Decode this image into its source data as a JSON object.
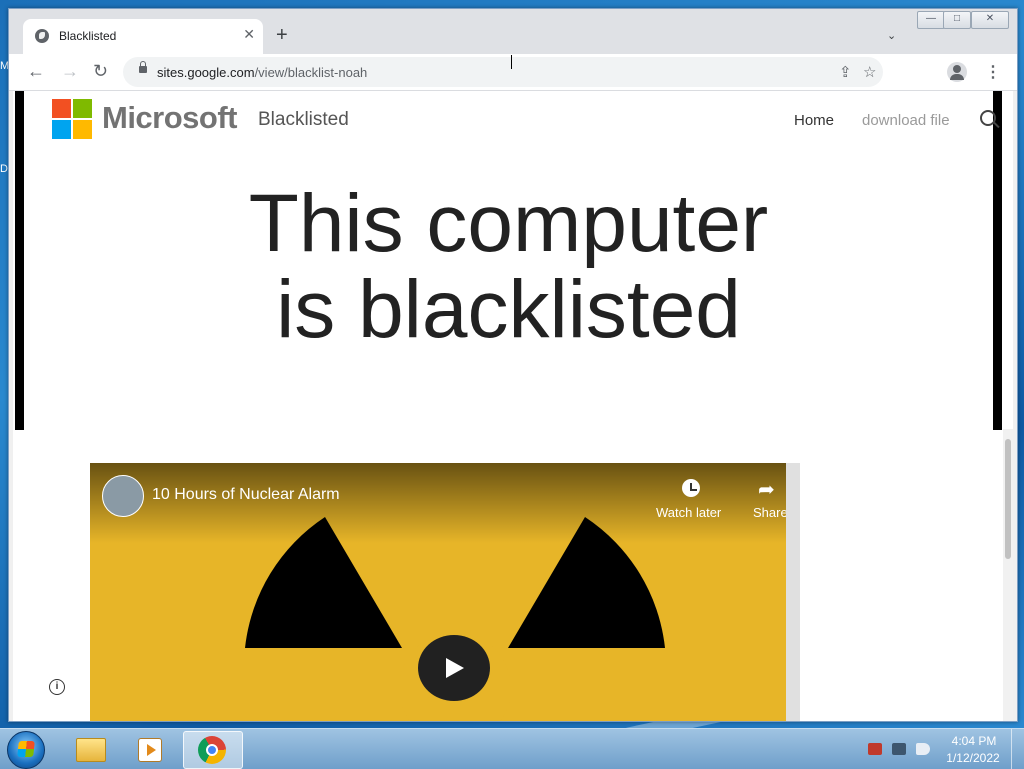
{
  "browser": {
    "tab": {
      "title": "Blacklisted",
      "close": "✕"
    },
    "new_tab": "+",
    "tab_search": "⌄",
    "window_controls": {
      "minimize": "—",
      "maximize": "□",
      "close": "✕"
    },
    "nav": {
      "back": "←",
      "forward": "→",
      "reload": "↻"
    },
    "url": {
      "host": "sites.google.com",
      "path": "/view/blacklist-noah"
    },
    "share_icon": "⇪",
    "bookmark_icon": "☆",
    "menu": "⋮"
  },
  "site": {
    "brand": "Microsoft",
    "site_name": "Blacklisted",
    "nav": {
      "home": "Home",
      "download": "download file"
    },
    "headline_line1": "This computer",
    "headline_line2": "is blacklisted",
    "info": "i",
    "colors": {
      "logo_red": "#f25022",
      "logo_green": "#7fba00",
      "logo_blue": "#00a4ef",
      "logo_yellow": "#ffb900"
    }
  },
  "video": {
    "title": "10 Hours of Nuclear Alarm",
    "watch_later": "Watch later",
    "share": "Share",
    "share_icon": "➦",
    "background_color": "#e7b528"
  },
  "taskbar": {
    "clock_time": "4:04 PM",
    "clock_date": "1/12/2022",
    "apps": [
      "windows-explorer",
      "media-player",
      "google-chrome"
    ]
  },
  "desktop": {
    "fragment1": "M",
    "fragment2": "D"
  }
}
